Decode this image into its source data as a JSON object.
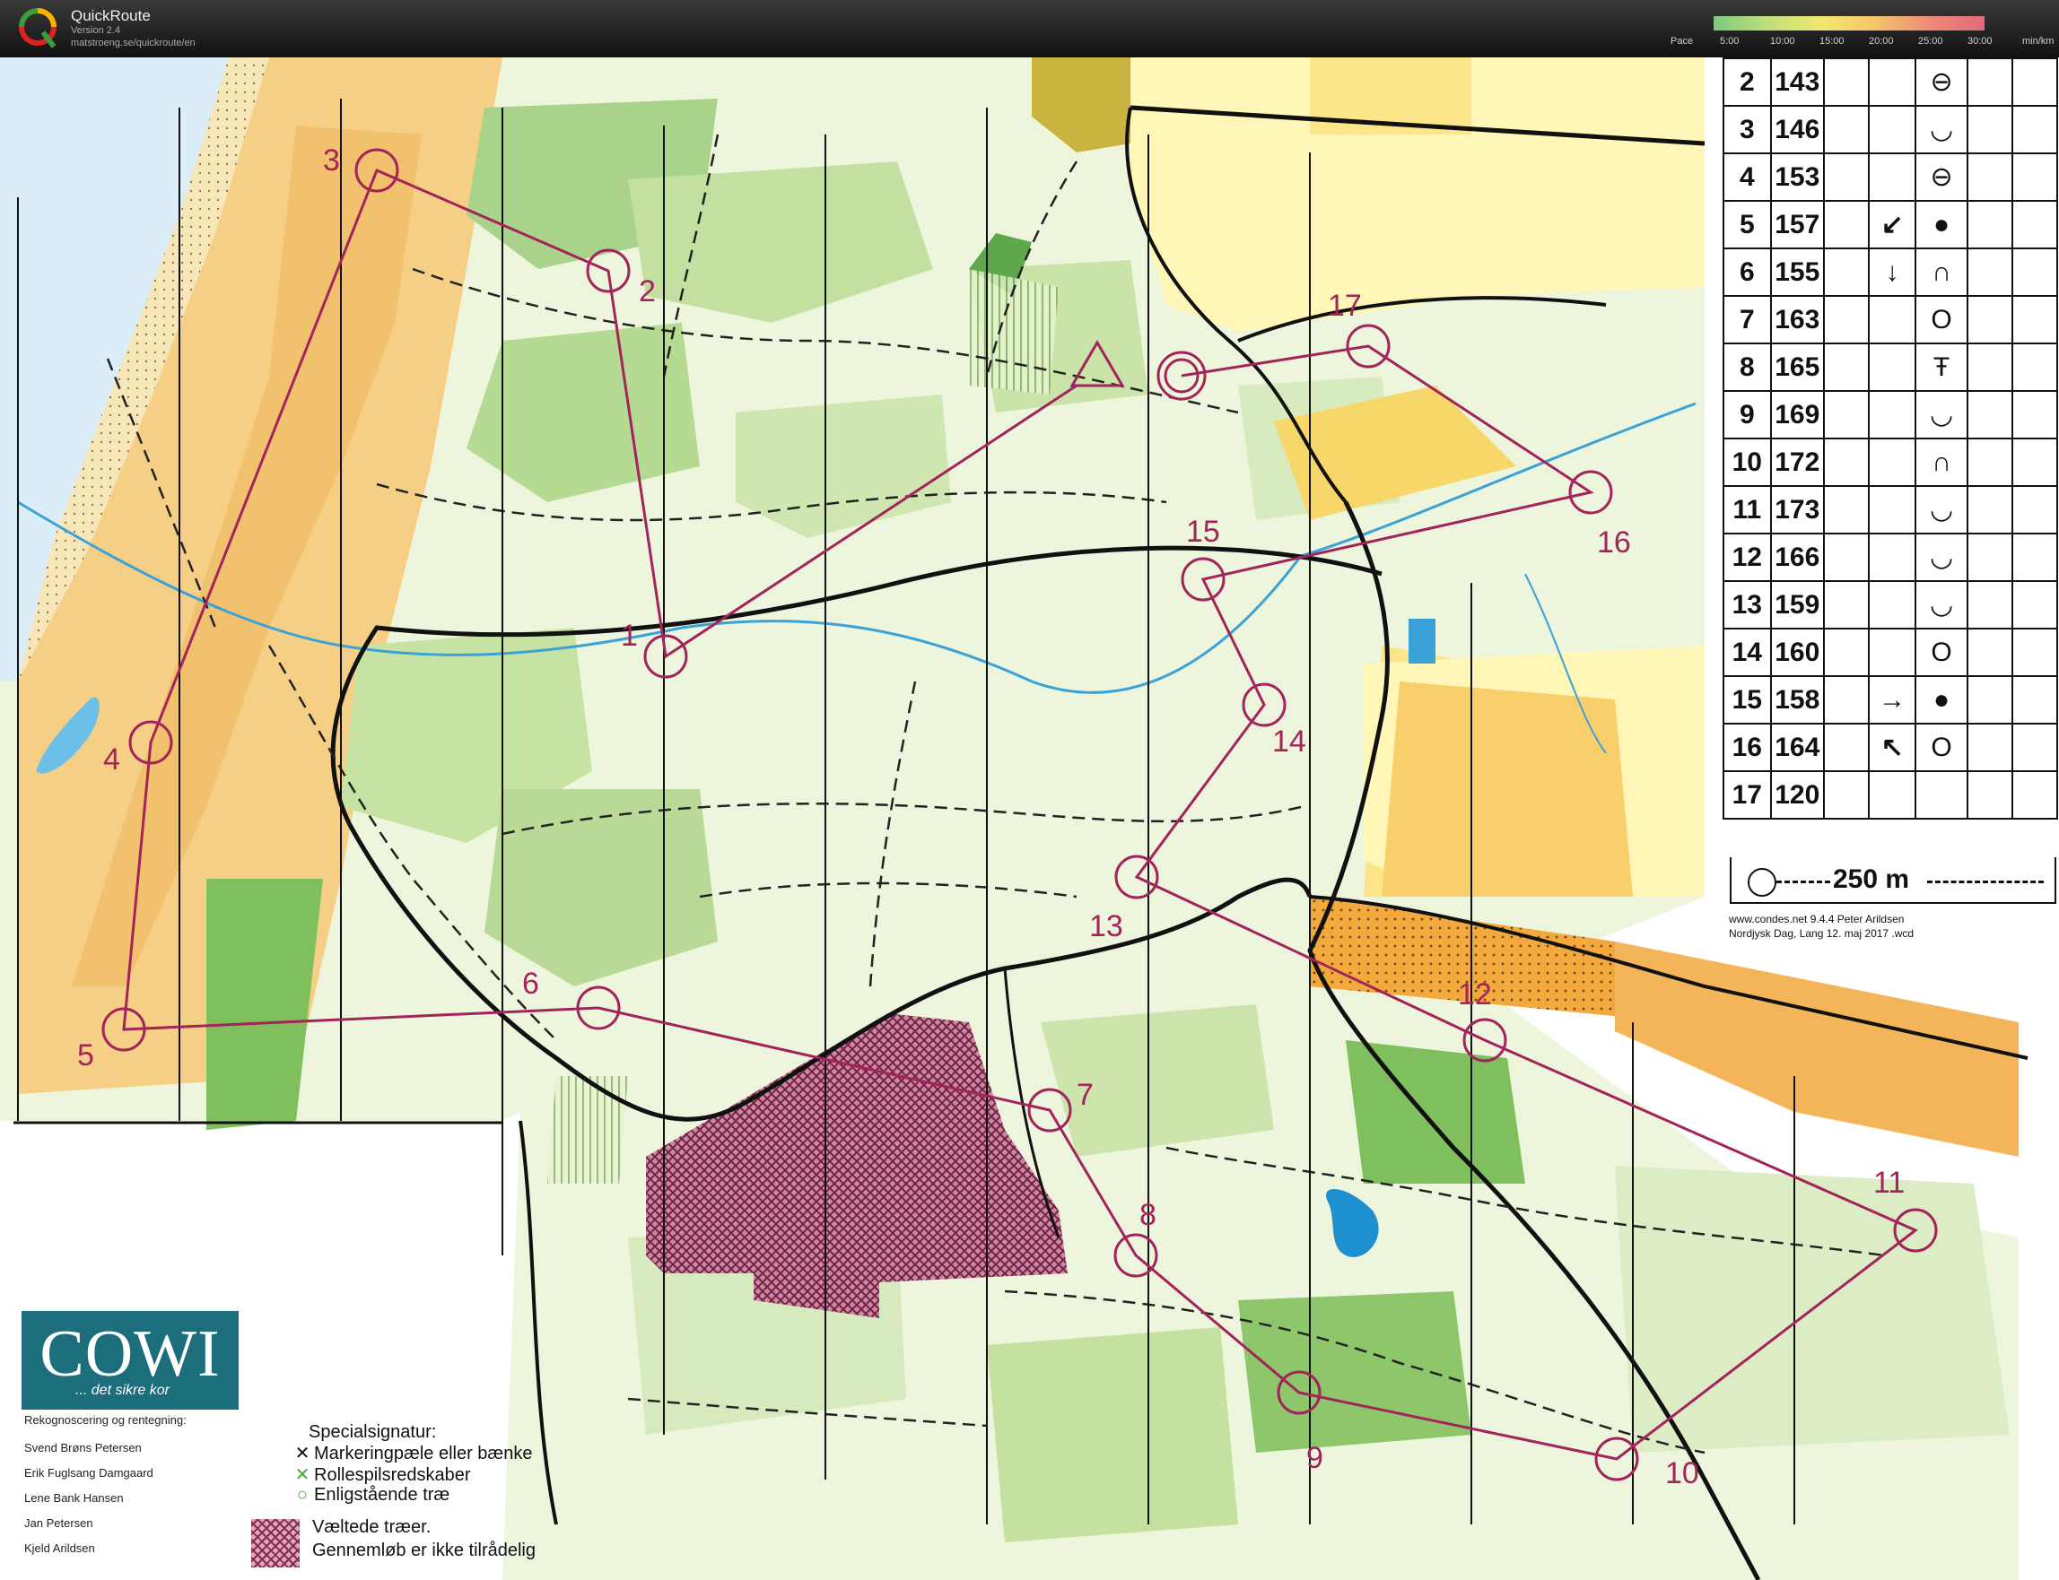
{
  "app": {
    "name": "QuickRoute",
    "version": "Version 2.4",
    "url": "matstroeng.se/quickroute/en"
  },
  "pace": {
    "label": "Pace",
    "ticks": [
      "5:00",
      "10:00",
      "15:00",
      "20:00",
      "25:00",
      "30:00"
    ],
    "unit": "min/km"
  },
  "controls": [
    {
      "n": "1"
    },
    {
      "n": "2"
    },
    {
      "n": "3"
    },
    {
      "n": "4"
    },
    {
      "n": "5"
    },
    {
      "n": "6"
    },
    {
      "n": "7"
    },
    {
      "n": "8"
    },
    {
      "n": "9"
    },
    {
      "n": "10"
    },
    {
      "n": "11"
    },
    {
      "n": "12"
    },
    {
      "n": "13"
    },
    {
      "n": "14"
    },
    {
      "n": "15"
    },
    {
      "n": "16"
    },
    {
      "n": "17"
    }
  ],
  "descriptions": {
    "rows": [
      {
        "num": "2",
        "code": "143",
        "dir": "",
        "feat": "⊖"
      },
      {
        "num": "3",
        "code": "146",
        "dir": "",
        "feat": "◡"
      },
      {
        "num": "4",
        "code": "153",
        "dir": "",
        "feat": "⊖"
      },
      {
        "num": "5",
        "code": "157",
        "dir": "↙",
        "feat": "●"
      },
      {
        "num": "6",
        "code": "155",
        "dir": "↓",
        "feat": "∩"
      },
      {
        "num": "7",
        "code": "163",
        "dir": "",
        "feat": "O"
      },
      {
        "num": "8",
        "code": "165",
        "dir": "",
        "feat": "Ŧ"
      },
      {
        "num": "9",
        "code": "169",
        "dir": "",
        "feat": "◡"
      },
      {
        "num": "10",
        "code": "172",
        "dir": "",
        "feat": "∩"
      },
      {
        "num": "11",
        "code": "173",
        "dir": "",
        "feat": "◡"
      },
      {
        "num": "12",
        "code": "166",
        "dir": "",
        "feat": "◡"
      },
      {
        "num": "13",
        "code": "159",
        "dir": "",
        "feat": "◡"
      },
      {
        "num": "14",
        "code": "160",
        "dir": "",
        "feat": "O"
      },
      {
        "num": "15",
        "code": "158",
        "dir": "→",
        "feat": "●"
      },
      {
        "num": "16",
        "code": "164",
        "dir": "↖",
        "feat": "O"
      },
      {
        "num": "17",
        "code": "120",
        "dir": "",
        "feat": ""
      }
    ],
    "scale": "250 m",
    "credit_line1": "www.condes.net 9.4.4 Peter Arildsen",
    "credit_line2": "Nordjysk Dag, Lang 12. maj 2017 .wcd"
  },
  "cowi": {
    "name": "COWI",
    "tagline": "... det sikre kor",
    "credits_title": "Rekognoscering og rentegning:",
    "people": [
      "Svend Brøns Petersen",
      "Erik Fuglsang Damgaard",
      "Lene Bank Hansen",
      "Jan Petersen",
      "Kjeld Arildsen"
    ]
  },
  "legend": {
    "title": "Specialsignatur:",
    "items": [
      {
        "mark": "✕",
        "text": "Markeringpæle eller bænke"
      },
      {
        "mark": "✕",
        "text": "Rollespilsredskaber"
      },
      {
        "mark": "○",
        "text": "Enligstående træ"
      }
    ],
    "hatch_line1": "Væltede træer.",
    "hatch_line2": "Gennemløb er ikke tilrådelig"
  },
  "colors": {
    "course": "#a3245a",
    "sand": "#f4c97a",
    "forest": "#cfe6a8",
    "green": "#74b85a",
    "field": "#fff4a8",
    "water": "#3aa2d6",
    "cowi": "#1c6e7c"
  }
}
